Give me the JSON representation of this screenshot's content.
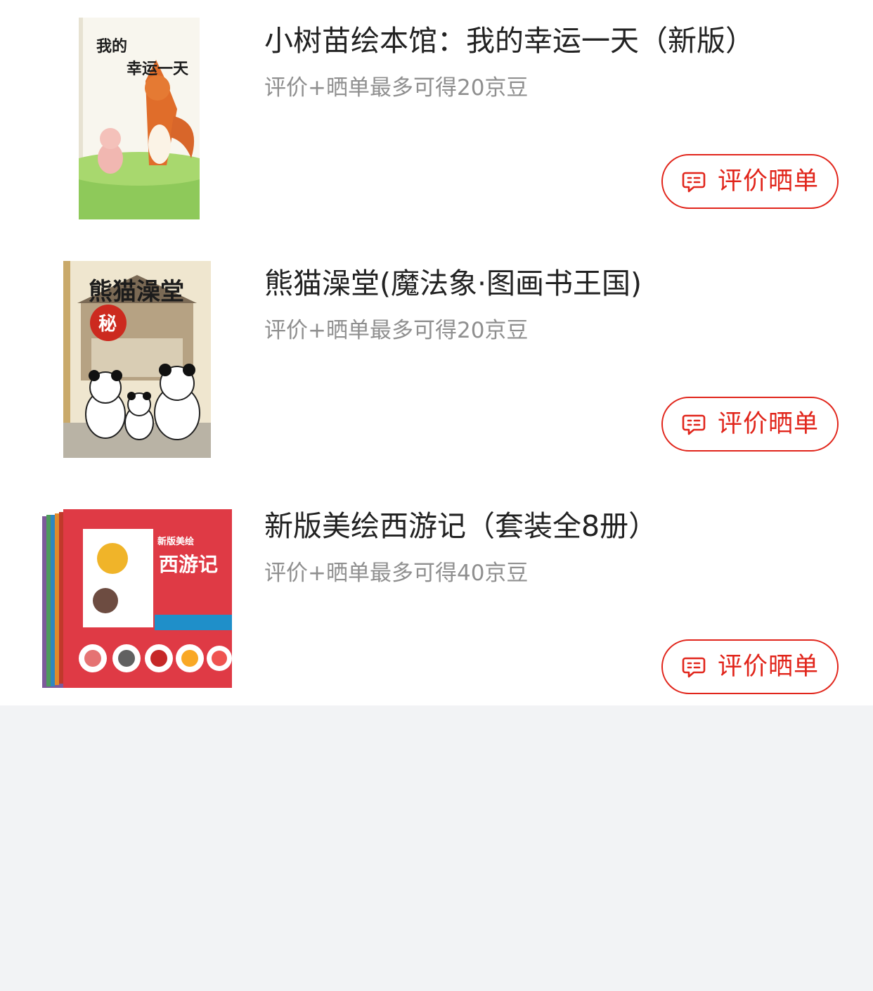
{
  "orders": [
    {
      "title": "小树苗绘本馆：我的幸运一天（新版）",
      "reward": "评价+晒单最多可得20京豆",
      "review_label": "评价晒单",
      "cover_text": "我的幸运一天"
    },
    {
      "title": "熊猫澡堂(魔法象·图画书王国)",
      "reward": "评价+晒单最多可得20京豆",
      "review_label": "评价晒单",
      "cover_text": "熊猫澡堂"
    },
    {
      "title": "新版美绘西游记（套装全8册）",
      "reward": "评价+晒单最多可得40京豆",
      "review_label": "评价晒单",
      "cover_text": "西游记"
    }
  ],
  "colors": {
    "accent": "#e1251b",
    "page_background": "#f2f3f5",
    "title_text": "#222222",
    "secondary_text": "#8f8f8f"
  },
  "icons": {
    "review_button": "chat-bubble-icon"
  }
}
